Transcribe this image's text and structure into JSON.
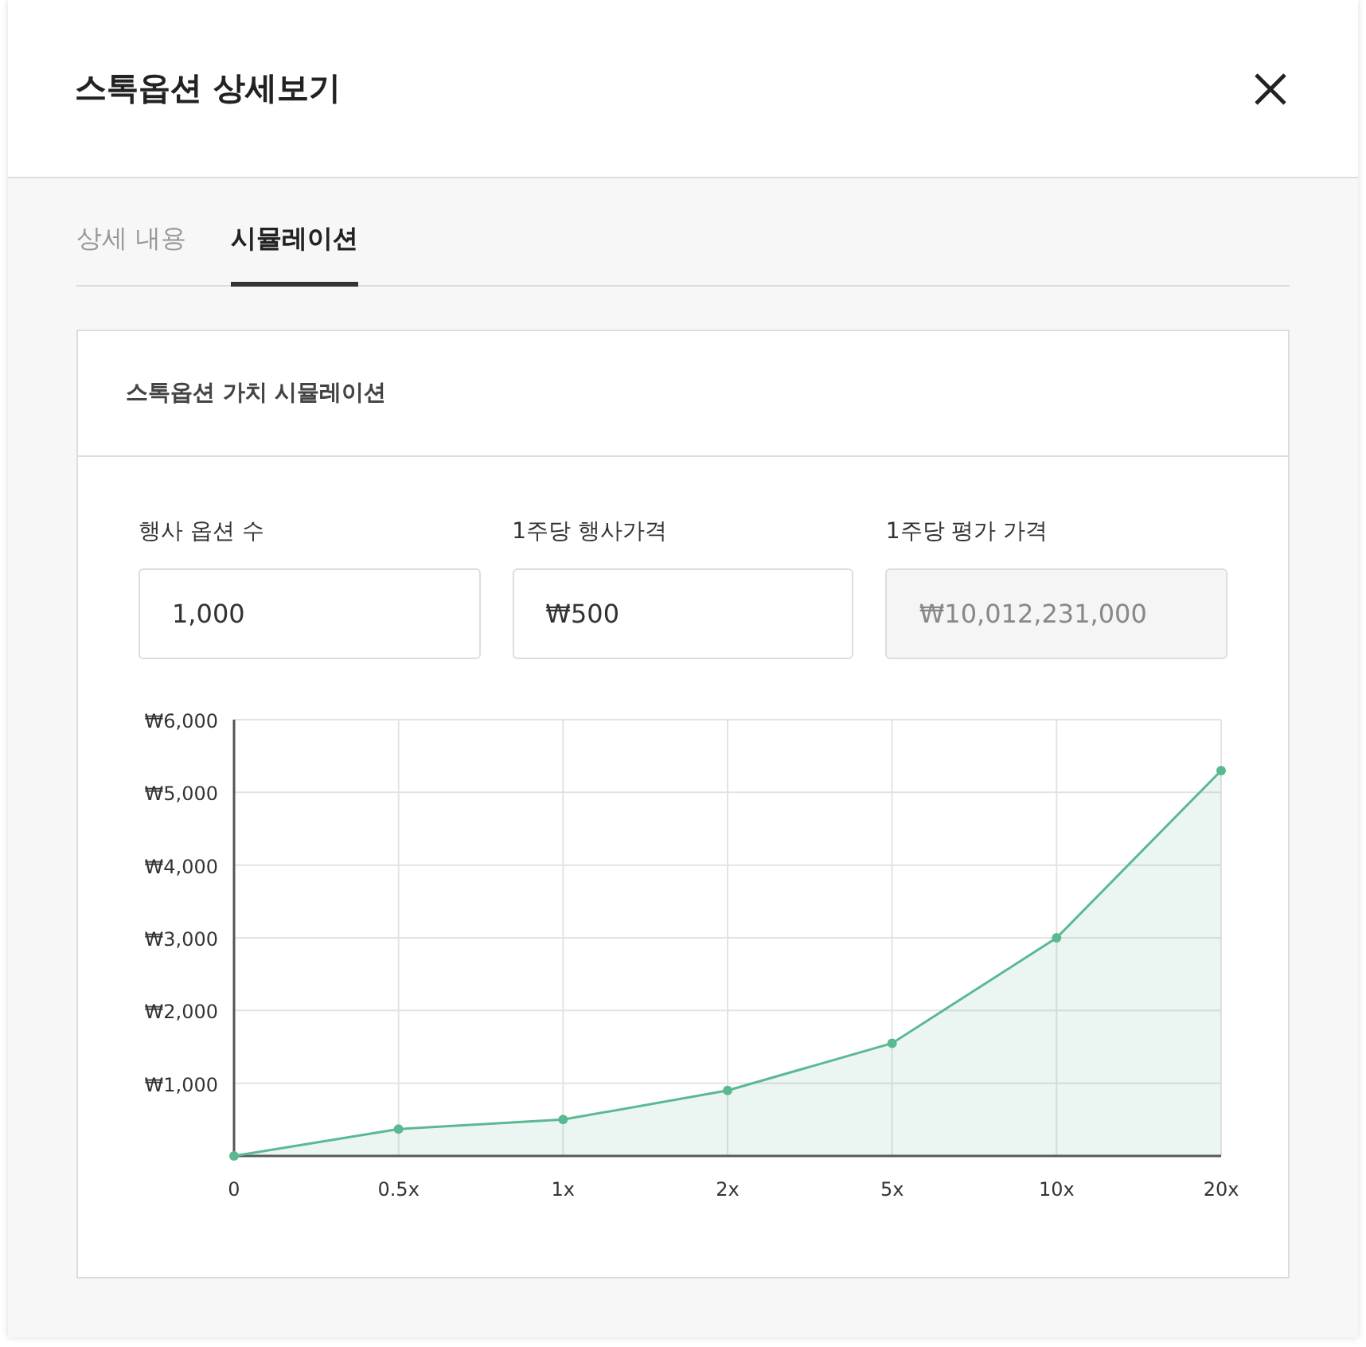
{
  "modal": {
    "title": "스톡옵션 상세보기"
  },
  "tabs": [
    {
      "label": "상세 내용",
      "selected": false
    },
    {
      "label": "시뮬레이션",
      "selected": true
    }
  ],
  "card": {
    "title": "스톡옵션 가치 시뮬레이션",
    "fields": [
      {
        "label": "행사 옵션 수",
        "value": "1,000",
        "disabled": false
      },
      {
        "label": "1주당 행사가격",
        "value": "₩500",
        "disabled": false
      },
      {
        "label": "1주당 평가 가격",
        "value": "₩10,012,231,000",
        "disabled": true
      }
    ],
    "chart_data": {
      "type": "area",
      "categories": [
        "0",
        "0.5x",
        "1x",
        "2x",
        "5x",
        "10x",
        "20x"
      ],
      "grid": true,
      "series": [
        {
          "color": "#5bb992",
          "values": [
            0,
            370,
            500,
            900,
            1550,
            3000,
            5300
          ]
        }
      ],
      "ylim": [
        0,
        6000
      ],
      "yticks": [
        {
          "value": 1000,
          "label": "₩1,000"
        },
        {
          "value": 2000,
          "label": "₩2,000"
        },
        {
          "value": 3000,
          "label": "₩3,000"
        },
        {
          "value": 4000,
          "label": "₩4,000"
        },
        {
          "value": 5000,
          "label": "₩5,000"
        },
        {
          "value": 6000,
          "label": "₩6,000"
        }
      ]
    }
  }
}
